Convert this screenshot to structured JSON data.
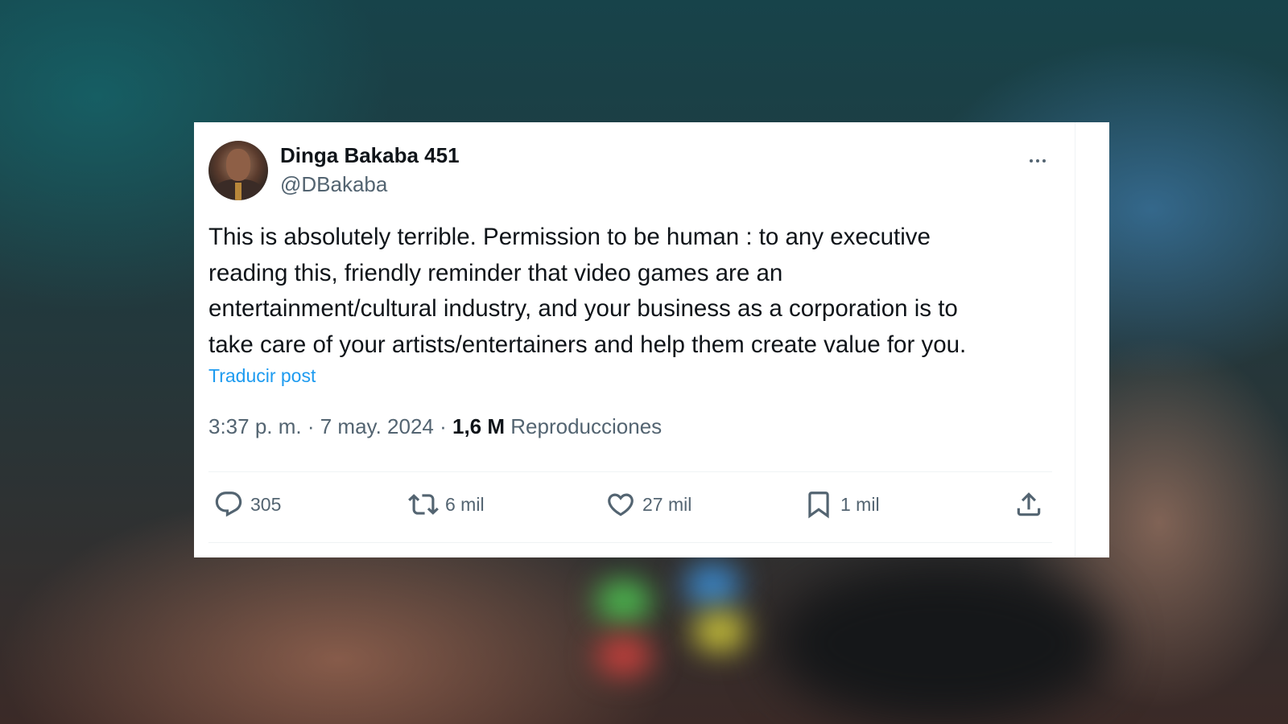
{
  "tweet": {
    "display_name": "Dinga Bakaba 451",
    "handle": "@DBakaba",
    "text": "This is absolutely terrible. Permission to be human : to any executive\nreading this, friendly reminder that video games are an\nentertainment/cultural industry, and your business as a corporation is to\ntake care of your artists/entertainers and help them create value for you.",
    "translate_label": "Traducir post",
    "timestamp": "3:37 p. m. · 7 may. 2024 · ",
    "views_count": "1,6 M",
    "views_label": "Reproducciones",
    "actions": {
      "replies": "305",
      "reposts": "6 mil",
      "likes": "27 mil",
      "bookmarks": "1 mil"
    }
  },
  "icons": [
    "more-icon",
    "reply-icon",
    "repost-icon",
    "like-icon",
    "bookmark-icon",
    "share-icon"
  ],
  "colors": {
    "text_primary": "#0f1419",
    "text_secondary": "#536471",
    "link": "#1d9bf0",
    "card_bg": "#ffffff"
  }
}
